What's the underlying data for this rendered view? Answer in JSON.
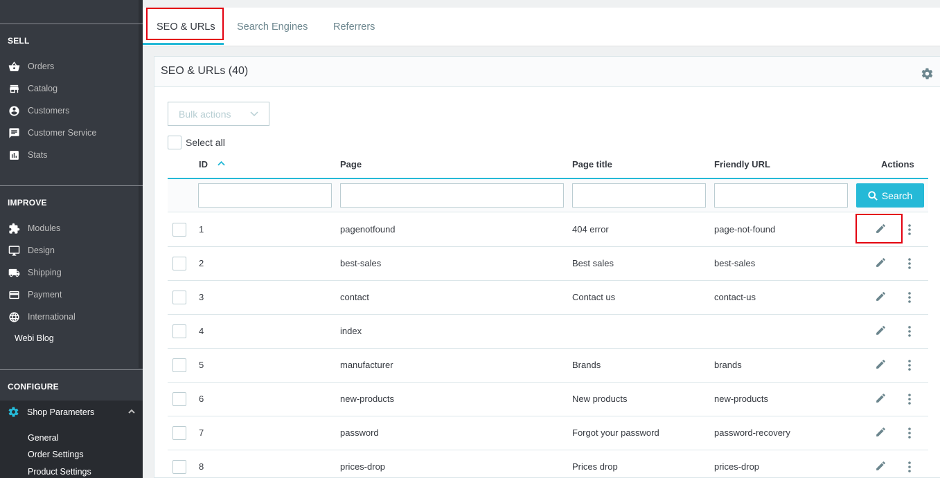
{
  "sidebar": {
    "sell_heading": "SELL",
    "sell_items": [
      {
        "label": "Orders",
        "icon": "basket-icon"
      },
      {
        "label": "Catalog",
        "icon": "store-icon"
      },
      {
        "label": "Customers",
        "icon": "account-circle-icon"
      },
      {
        "label": "Customer Service",
        "icon": "chat-icon"
      },
      {
        "label": "Stats",
        "icon": "bar-chart-icon"
      }
    ],
    "improve_heading": "IMPROVE",
    "improve_items": [
      {
        "label": "Modules",
        "icon": "puzzle-icon"
      },
      {
        "label": "Design",
        "icon": "monitor-icon"
      },
      {
        "label": "Shipping",
        "icon": "truck-icon"
      },
      {
        "label": "Payment",
        "icon": "credit-card-icon"
      },
      {
        "label": "International",
        "icon": "globe-icon"
      }
    ],
    "webi_blog": "Webi Blog",
    "configure_heading": "CONFIGURE",
    "shop_parameters": "Shop Parameters",
    "shop_sub_items": [
      "General",
      "Order Settings",
      "Product Settings"
    ]
  },
  "tabs": [
    {
      "label": "SEO & URLs",
      "active": true
    },
    {
      "label": "Search Engines",
      "active": false
    },
    {
      "label": "Referrers",
      "active": false
    }
  ],
  "card": {
    "title": "SEO & URLs (40)",
    "bulk_actions": "Bulk actions",
    "select_all": "Select all",
    "search_button": "Search"
  },
  "table": {
    "columns": [
      "ID",
      "Page",
      "Page title",
      "Friendly URL",
      "Actions"
    ],
    "sort_column": "ID",
    "sort_direction": "asc",
    "rows": [
      {
        "id": "1",
        "page": "pagenotfound",
        "title": "404 error",
        "url": "page-not-found"
      },
      {
        "id": "2",
        "page": "best-sales",
        "title": "Best sales",
        "url": "best-sales"
      },
      {
        "id": "3",
        "page": "contact",
        "title": "Contact us",
        "url": "contact-us"
      },
      {
        "id": "4",
        "page": "index",
        "title": "",
        "url": ""
      },
      {
        "id": "5",
        "page": "manufacturer",
        "title": "Brands",
        "url": "brands"
      },
      {
        "id": "6",
        "page": "new-products",
        "title": "New products",
        "url": "new-products"
      },
      {
        "id": "7",
        "page": "password",
        "title": "Forgot your password",
        "url": "password-recovery"
      },
      {
        "id": "8",
        "page": "prices-drop",
        "title": "Prices drop",
        "url": "prices-drop"
      }
    ]
  },
  "colors": {
    "sidebar_bg": "#363a41",
    "accent": "#25b9d7",
    "highlight_box": "#e3000f"
  }
}
